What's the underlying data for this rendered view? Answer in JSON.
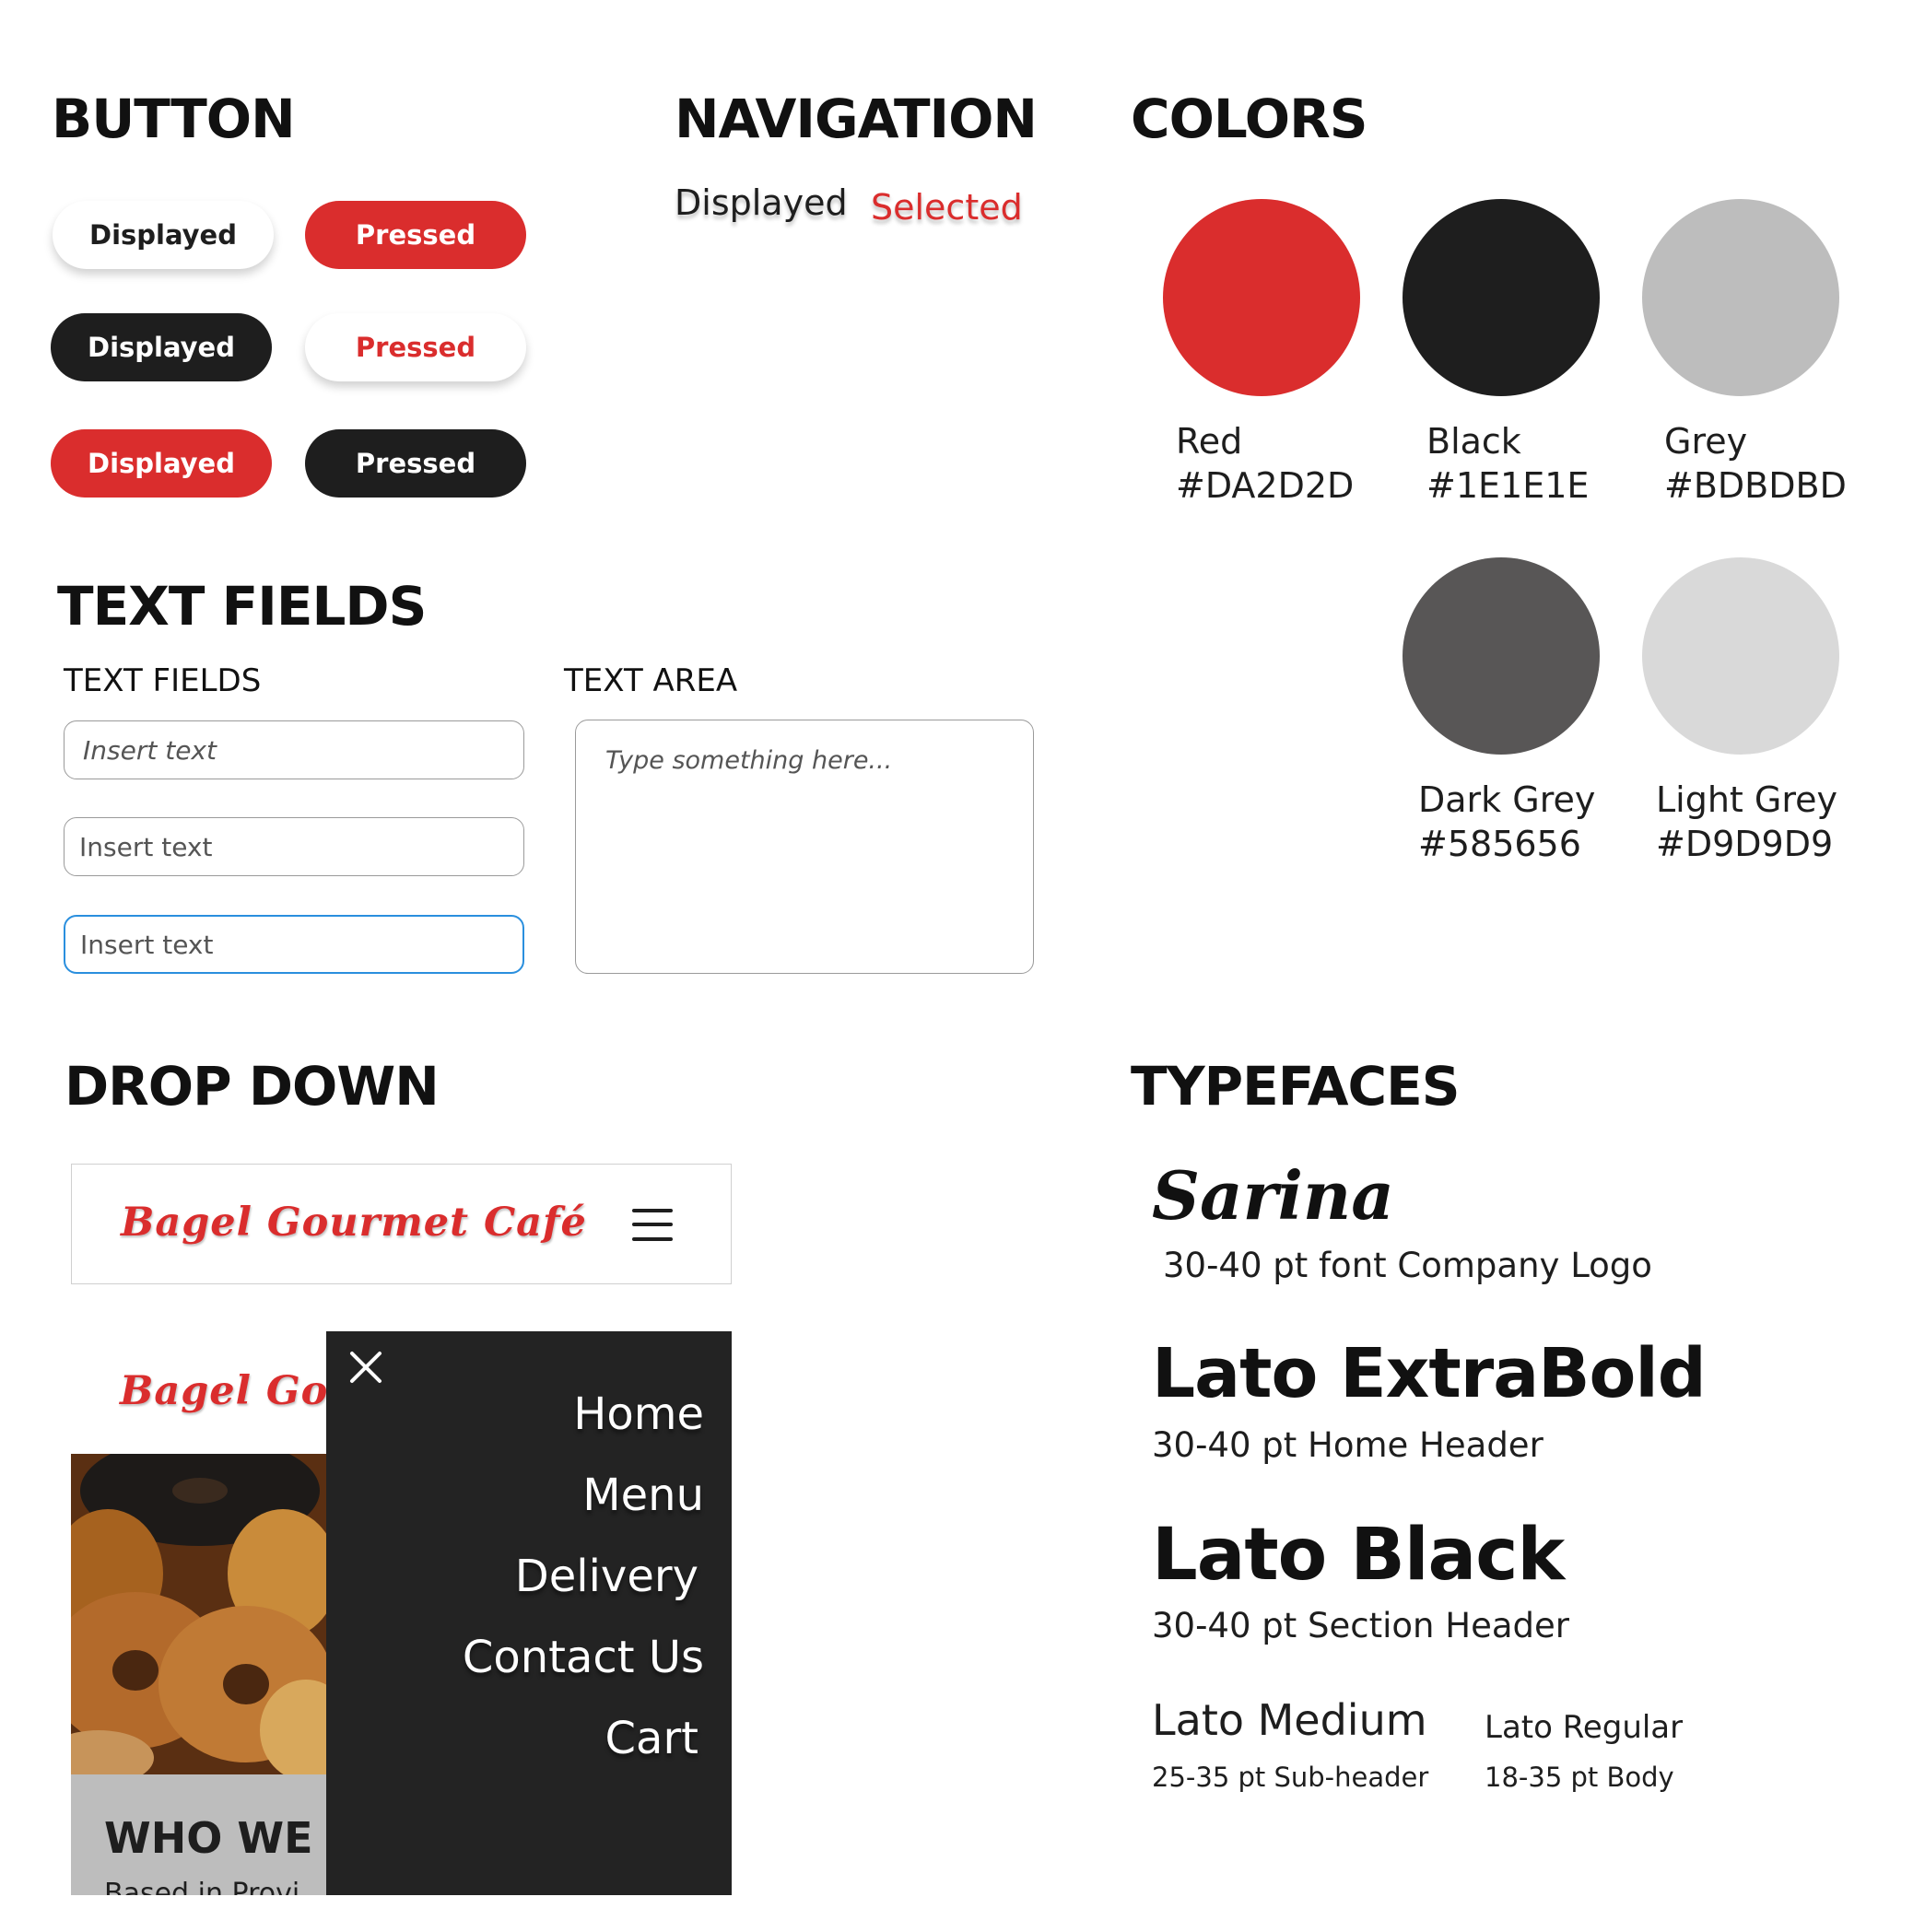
{
  "button": {
    "title": "BUTTON",
    "rows": [
      {
        "displayed": "Displayed",
        "pressed": "Pressed"
      },
      {
        "displayed": "Displayed",
        "pressed": "Pressed"
      },
      {
        "displayed": "Displayed",
        "pressed": "Pressed"
      }
    ]
  },
  "navigation": {
    "title": "NAVIGATION",
    "displayed": "Displayed",
    "selected": "Selected"
  },
  "colors": {
    "title": "COLORS",
    "swatches": [
      {
        "name": "Red",
        "hex": "#DA2D2D"
      },
      {
        "name": "Black",
        "hex": "#1E1E1E"
      },
      {
        "name": "Grey",
        "hex": "#BDBDBD"
      },
      {
        "name": "Dark Grey",
        "hex": "#585656"
      },
      {
        "name": "Light Grey",
        "hex": "#D9D9D9"
      }
    ]
  },
  "text_fields": {
    "title": "TEXT FIELDS",
    "fields_label": "TEXT FIELDS",
    "area_label": "TEXT AREA",
    "fields": [
      {
        "placeholder": "Insert text"
      },
      {
        "placeholder": "Insert text"
      },
      {
        "placeholder": "Insert text"
      }
    ],
    "area_placeholder": "Type something here...",
    "focus_color": "#2A8FDE"
  },
  "drop_down": {
    "title": "DROP DOWN",
    "logo_text": "Bagel Gourmet Café",
    "logo_text_clipped": "Bagel Go",
    "menu_items": [
      "Home",
      "Menu",
      "Delivery",
      "Contact Us",
      "Cart"
    ],
    "section_heading_clipped": "WHO WE A",
    "body_clipped": "Based in Provi",
    "menu_bg": "#232323"
  },
  "typefaces": {
    "title": "TYPEFACES",
    "items": [
      {
        "name": "Sarina",
        "desc": "30-40 pt font Company Logo"
      },
      {
        "name": "Lato ExtraBold",
        "desc": "30-40 pt Home Header"
      },
      {
        "name": "Lato Black",
        "desc": "30-40 pt Section Header"
      },
      {
        "name": "Lato Medium",
        "desc": "25-35 pt Sub-header"
      },
      {
        "name": "Lato Regular",
        "desc": "18-35 pt Body"
      }
    ]
  }
}
